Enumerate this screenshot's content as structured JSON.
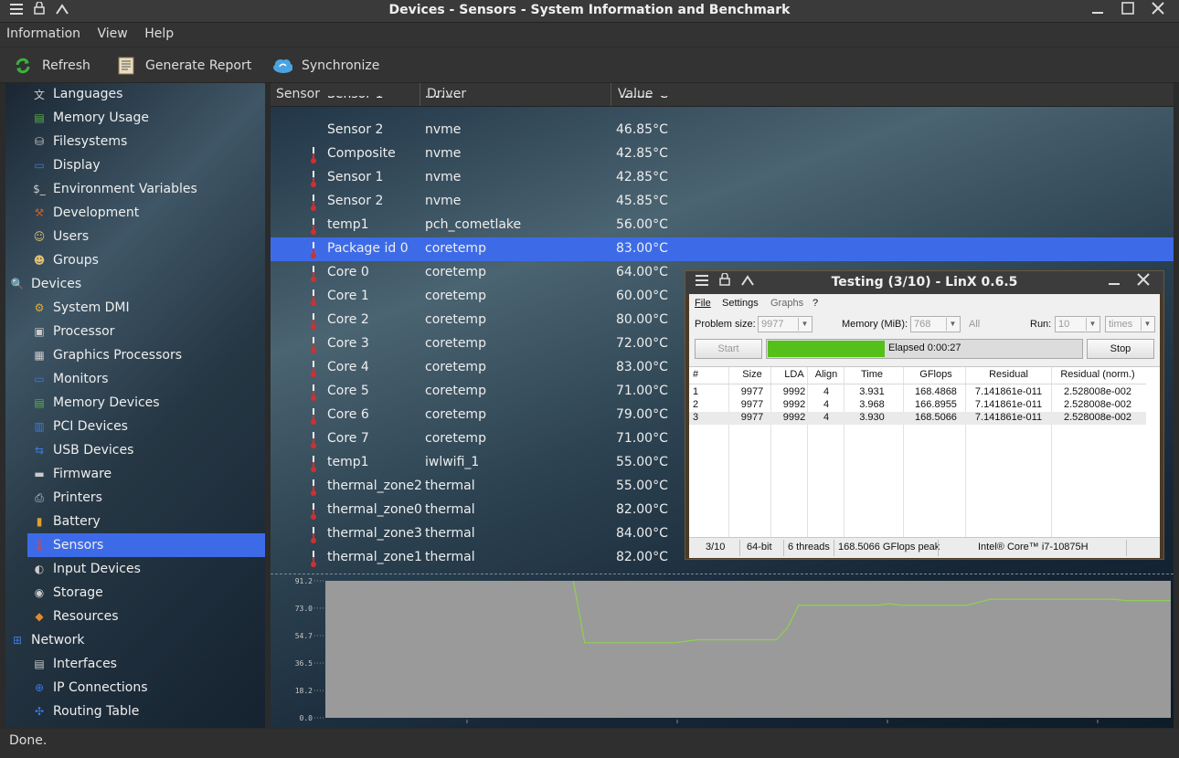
{
  "window": {
    "title": "Devices - Sensors - System Information and Benchmark",
    "menu_icon": "hamburger-icon",
    "pin_icon": "lock-icon",
    "shade_icon": "chevron-up-icon"
  },
  "menubar": [
    "Information",
    "View",
    "Help"
  ],
  "toolbar": {
    "refresh": "Refresh",
    "generate_report": "Generate Report",
    "synchronize": "Synchronize"
  },
  "sidebar": {
    "items": [
      {
        "label": "Languages",
        "icon": "languages-icon",
        "indent": 1
      },
      {
        "label": "Memory Usage",
        "icon": "memory-icon",
        "indent": 1
      },
      {
        "label": "Filesystems",
        "icon": "filesystems-icon",
        "indent": 1
      },
      {
        "label": "Display",
        "icon": "display-icon",
        "indent": 1
      },
      {
        "label": "Environment Variables",
        "icon": "terminal-icon",
        "indent": 1
      },
      {
        "label": "Development",
        "icon": "development-icon",
        "indent": 1
      },
      {
        "label": "Users",
        "icon": "users-icon",
        "indent": 1
      },
      {
        "label": "Groups",
        "icon": "groups-icon",
        "indent": 1
      },
      {
        "label": "Devices",
        "icon": "devices-icon",
        "indent": 0
      },
      {
        "label": "System DMI",
        "icon": "dmi-icon",
        "indent": 1
      },
      {
        "label": "Processor",
        "icon": "cpu-icon",
        "indent": 1
      },
      {
        "label": "Graphics Processors",
        "icon": "gpu-icon",
        "indent": 1
      },
      {
        "label": "Monitors",
        "icon": "monitor-icon",
        "indent": 1
      },
      {
        "label": "Memory Devices",
        "icon": "memory-icon",
        "indent": 1
      },
      {
        "label": "PCI Devices",
        "icon": "pci-icon",
        "indent": 1
      },
      {
        "label": "USB Devices",
        "icon": "usb-icon",
        "indent": 1
      },
      {
        "label": "Firmware",
        "icon": "flash-icon",
        "indent": 1
      },
      {
        "label": "Printers",
        "icon": "printer-icon",
        "indent": 1
      },
      {
        "label": "Battery",
        "icon": "battery-icon",
        "indent": 1
      },
      {
        "label": "Sensors",
        "icon": "thermometer-icon",
        "indent": 1,
        "selected": true
      },
      {
        "label": "Input Devices",
        "icon": "mouse-icon",
        "indent": 1
      },
      {
        "label": "Storage",
        "icon": "disk-icon",
        "indent": 1
      },
      {
        "label": "Resources",
        "icon": "resources-icon",
        "indent": 1
      },
      {
        "label": "Network",
        "icon": "network-icon",
        "indent": 0
      },
      {
        "label": "Interfaces",
        "icon": "interfaces-icon",
        "indent": 1
      },
      {
        "label": "IP Connections",
        "icon": "globe-icon",
        "indent": 1
      },
      {
        "label": "Routing Table",
        "icon": "routing-icon",
        "indent": 1
      }
    ]
  },
  "table": {
    "headers": {
      "sensor": "Sensor",
      "driver": "Driver",
      "value": "Value"
    },
    "partial_row": {
      "sensor": "Sensor 1",
      "driver": "nvme",
      "value": "42.85°C"
    },
    "rows": [
      {
        "sensor": "Sensor 2",
        "driver": "nvme",
        "value": "46.85°C",
        "icon": false
      },
      {
        "sensor": "Composite",
        "driver": "nvme",
        "value": "42.85°C",
        "icon": true
      },
      {
        "sensor": "Sensor 1",
        "driver": "nvme",
        "value": "42.85°C",
        "icon": true
      },
      {
        "sensor": "Sensor 2",
        "driver": "nvme",
        "value": "45.85°C",
        "icon": true
      },
      {
        "sensor": "temp1",
        "driver": "pch_cometlake",
        "value": "56.00°C",
        "icon": true
      },
      {
        "sensor": "Package id 0",
        "driver": "coretemp",
        "value": "83.00°C",
        "icon": true,
        "selected": true
      },
      {
        "sensor": "Core 0",
        "driver": "coretemp",
        "value": "64.00°C",
        "icon": true
      },
      {
        "sensor": "Core 1",
        "driver": "coretemp",
        "value": "60.00°C",
        "icon": true
      },
      {
        "sensor": "Core 2",
        "driver": "coretemp",
        "value": "80.00°C",
        "icon": true
      },
      {
        "sensor": "Core 3",
        "driver": "coretemp",
        "value": "72.00°C",
        "icon": true
      },
      {
        "sensor": "Core 4",
        "driver": "coretemp",
        "value": "83.00°C",
        "icon": true
      },
      {
        "sensor": "Core 5",
        "driver": "coretemp",
        "value": "71.00°C",
        "icon": true
      },
      {
        "sensor": "Core 6",
        "driver": "coretemp",
        "value": "79.00°C",
        "icon": true
      },
      {
        "sensor": "Core 7",
        "driver": "coretemp",
        "value": "71.00°C",
        "icon": true
      },
      {
        "sensor": "temp1",
        "driver": "iwlwifi_1",
        "value": "55.00°C",
        "icon": true
      },
      {
        "sensor": "thermal_zone2",
        "driver": "thermal",
        "value": "55.00°C",
        "icon": true
      },
      {
        "sensor": "thermal_zone0",
        "driver": "thermal",
        "value": "82.00°C",
        "icon": true
      },
      {
        "sensor": "thermal_zone3",
        "driver": "thermal",
        "value": "84.00°C",
        "icon": true
      },
      {
        "sensor": "thermal_zone1",
        "driver": "thermal",
        "value": "82.00°C",
        "icon": true
      }
    ]
  },
  "chart_data": {
    "type": "line",
    "title": "",
    "ylim": [
      0,
      91.2
    ],
    "y_ticks": [
      "91.2",
      "73.0",
      "54.7",
      "36.5",
      "18.2",
      "0.0"
    ],
    "series": [
      {
        "color": "#8fd14f",
        "values": [
          null,
          null,
          null,
          null,
          null,
          null,
          null,
          null,
          null,
          null,
          null,
          null,
          null,
          null,
          null,
          null,
          null,
          null,
          null,
          null,
          null,
          null,
          91.2,
          50,
          50,
          50,
          50,
          50,
          50,
          50,
          50,
          50,
          51,
          52,
          52,
          52,
          52,
          52,
          52,
          52,
          52,
          60,
          75,
          75,
          75,
          75,
          75,
          75,
          75,
          75,
          76,
          75,
          75,
          75,
          75,
          75,
          75,
          75,
          77,
          79,
          79,
          79,
          79,
          79,
          79,
          79,
          79,
          79,
          79,
          79,
          79,
          78,
          78,
          78,
          78,
          78
        ]
      }
    ]
  },
  "linx": {
    "title": "Testing (3/10) - LinX 0.6.5",
    "menu": [
      "File",
      "Settings",
      "Graphs",
      "?"
    ],
    "problem_size_label": "Problem size:",
    "problem_size_value": "9977",
    "memory_label": "Memory (MiB):",
    "memory_value": "768",
    "all_label": "All",
    "run_label": "Run:",
    "run_value": "10",
    "run_unit": "times",
    "start_label": "Start",
    "elapsed": "Elapsed 0:00:27",
    "progress": 0.37,
    "progress_color": "#55c01a",
    "stop_label": "Stop",
    "columns": [
      "#",
      "Size",
      "LDA",
      "Align",
      "Time",
      "GFlops",
      "Residual",
      "Residual (norm.)"
    ],
    "rows": [
      [
        "1",
        "9977",
        "9992",
        "4",
        "3.931",
        "168.4868",
        "7.141861e-011",
        "2.528008e-002"
      ],
      [
        "2",
        "9977",
        "9992",
        "4",
        "3.968",
        "166.8955",
        "7.141861e-011",
        "2.528008e-002"
      ],
      [
        "3",
        "9977",
        "9992",
        "4",
        "3.930",
        "168.5066",
        "7.141861e-011",
        "2.528008e-002"
      ]
    ],
    "status": {
      "run": "3/10",
      "bits": "64-bit",
      "threads": "6 threads",
      "peak": "168.5066 GFlops peak",
      "cpu": "Intel® Core™ i7-10875H"
    }
  },
  "statusbar": {
    "text": "Done."
  }
}
